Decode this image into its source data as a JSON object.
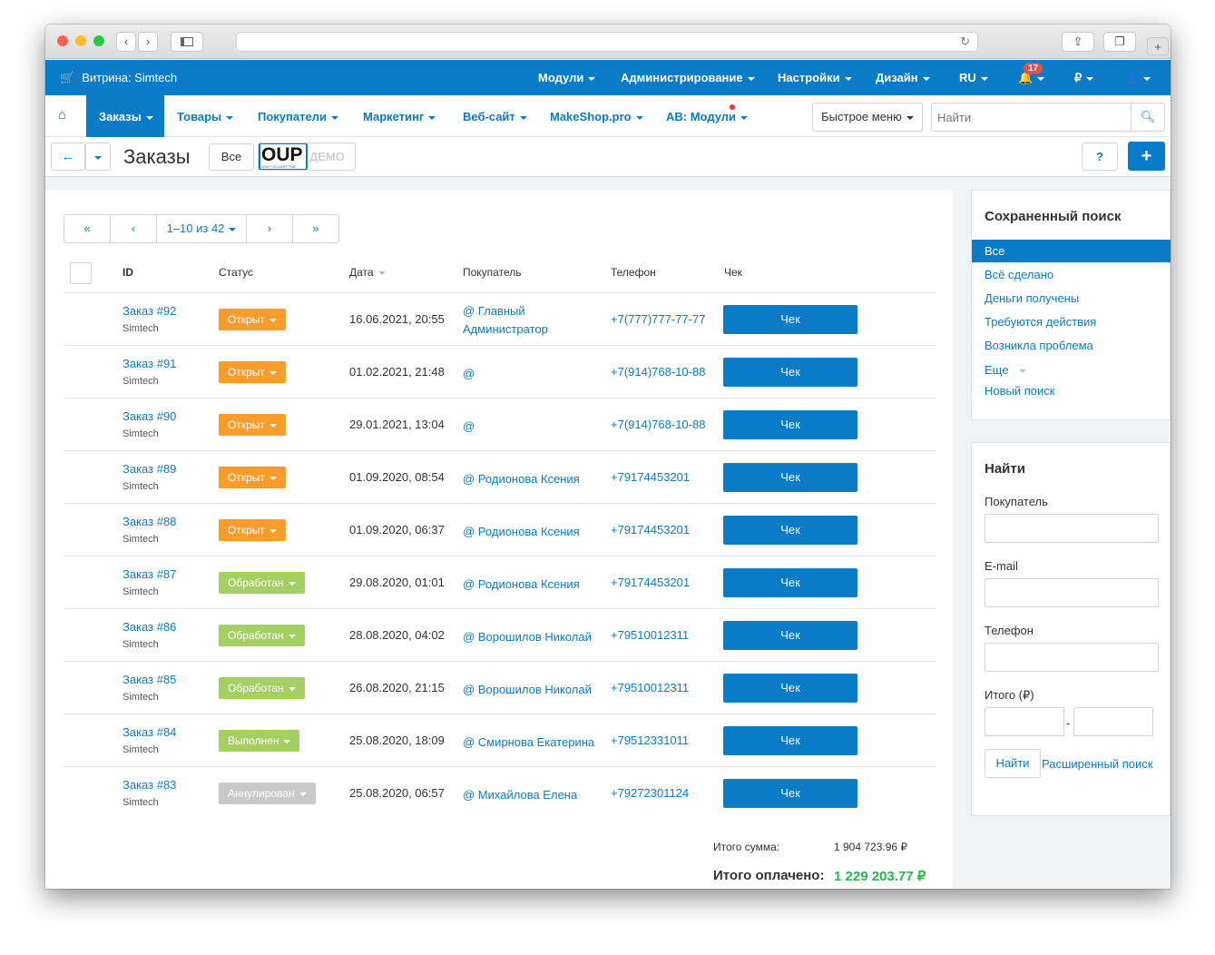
{
  "browser": {
    "url": ""
  },
  "topbar": {
    "storefront": "Витрина: Simtech",
    "menus": [
      "Модули",
      "Администрирование",
      "Настройки",
      "Дизайн",
      "RU"
    ],
    "notifications_count": "17",
    "currency": "₽"
  },
  "nav": {
    "items": [
      "Заказы",
      "Товары",
      "Покупатели",
      "Маркетинг",
      "Веб-сайт",
      "MakeShop.pro",
      "АВ: Модули"
    ],
    "quick_menu": "Быстрое меню",
    "search_placeholder": "Найти"
  },
  "titlebar": {
    "title": "Заказы",
    "filter_all": "Все",
    "logo_text": "OUP",
    "logo_sub": "LENT CS-CART THE",
    "demo_text": "ДЕМО"
  },
  "pager": {
    "first": "«",
    "prev": "‹",
    "range": "1–10 из 42",
    "next": "›",
    "last": "»"
  },
  "table": {
    "headers": [
      "ID",
      "Статус",
      "Дата",
      "Покупатель",
      "Телефон",
      "Чек"
    ],
    "rows": [
      {
        "id": "Заказ #92",
        "store": "Simtech",
        "status": "Открыт",
        "date": "16.06.2021, 20:55",
        "customer": "@ Главный Администратор",
        "phone": "+7(777)777-77-77",
        "check": "Чек"
      },
      {
        "id": "Заказ #91",
        "store": "Simtech",
        "status": "Открыт",
        "date": "01.02.2021, 21:48",
        "customer": "@",
        "phone": "+7(914)768-10-88",
        "check": "Чек"
      },
      {
        "id": "Заказ #90",
        "store": "Simtech",
        "status": "Открыт",
        "date": "29.01.2021, 13:04",
        "customer": "@",
        "phone": "+7(914)768-10-88",
        "check": "Чек"
      },
      {
        "id": "Заказ #89",
        "store": "Simtech",
        "status": "Открыт",
        "date": "01.09.2020, 08:54",
        "customer": "@ Родионова Ксения",
        "phone": "+79174453201",
        "check": "Чек"
      },
      {
        "id": "Заказ #88",
        "store": "Simtech",
        "status": "Открыт",
        "date": "01.09.2020, 06:37",
        "customer": "@ Родионова Ксения",
        "phone": "+79174453201",
        "check": "Чек"
      },
      {
        "id": "Заказ #87",
        "store": "Simtech",
        "status": "Обработан",
        "date": "29.08.2020, 01:01",
        "customer": "@ Родионова Ксения",
        "phone": "+79174453201",
        "check": "Чек"
      },
      {
        "id": "Заказ #86",
        "store": "Simtech",
        "status": "Обработан",
        "date": "28.08.2020, 04:02",
        "customer": "@ Ворошилов Николай",
        "phone": "+79510012311",
        "check": "Чек"
      },
      {
        "id": "Заказ #85",
        "store": "Simtech",
        "status": "Обработан",
        "date": "26.08.2020, 21:15",
        "customer": "@ Ворошилов Николай",
        "phone": "+79510012311",
        "check": "Чек"
      },
      {
        "id": "Заказ #84",
        "store": "Simtech",
        "status": "Выполнен",
        "date": "25.08.2020, 18:09",
        "customer": "@ Смирнова Екатерина",
        "phone": "+79512331011",
        "check": "Чек"
      },
      {
        "id": "Заказ #83",
        "store": "Simtech",
        "status": "Аннулирован",
        "date": "25.08.2020, 06:57",
        "customer": "@ Михайлова Елена",
        "phone": "+79272301124",
        "check": "Чек"
      }
    ]
  },
  "totals": {
    "sum_label": "Итого сумма:",
    "sum_value": "1 904 723.96 ₽",
    "paid_label": "Итого оплачено:",
    "paid_value": "1 229 203.77 ₽"
  },
  "saved_search": {
    "title": "Сохраненный поиск",
    "items": [
      "Все",
      "Всё сделано",
      "Деньги получены",
      "Требуются действия",
      "Возникла проблема",
      "Еще",
      "Новый поиск"
    ]
  },
  "find": {
    "title": "Найти",
    "customer_label": "Покупатель",
    "email_label": "E-mail",
    "phone_label": "Телефон",
    "total_label": "Итого (₽)",
    "range_sep": "-",
    "find_button": "Найти",
    "advanced_link": "Расширенный поиск"
  },
  "colors": {
    "accent": "#0a7bc6",
    "status_open": "#f89c2b",
    "status_processed": "#a3d061",
    "status_complete": "#a3d061",
    "status_cancelled": "#c9c9c9",
    "paid_value": "#27b84a"
  }
}
